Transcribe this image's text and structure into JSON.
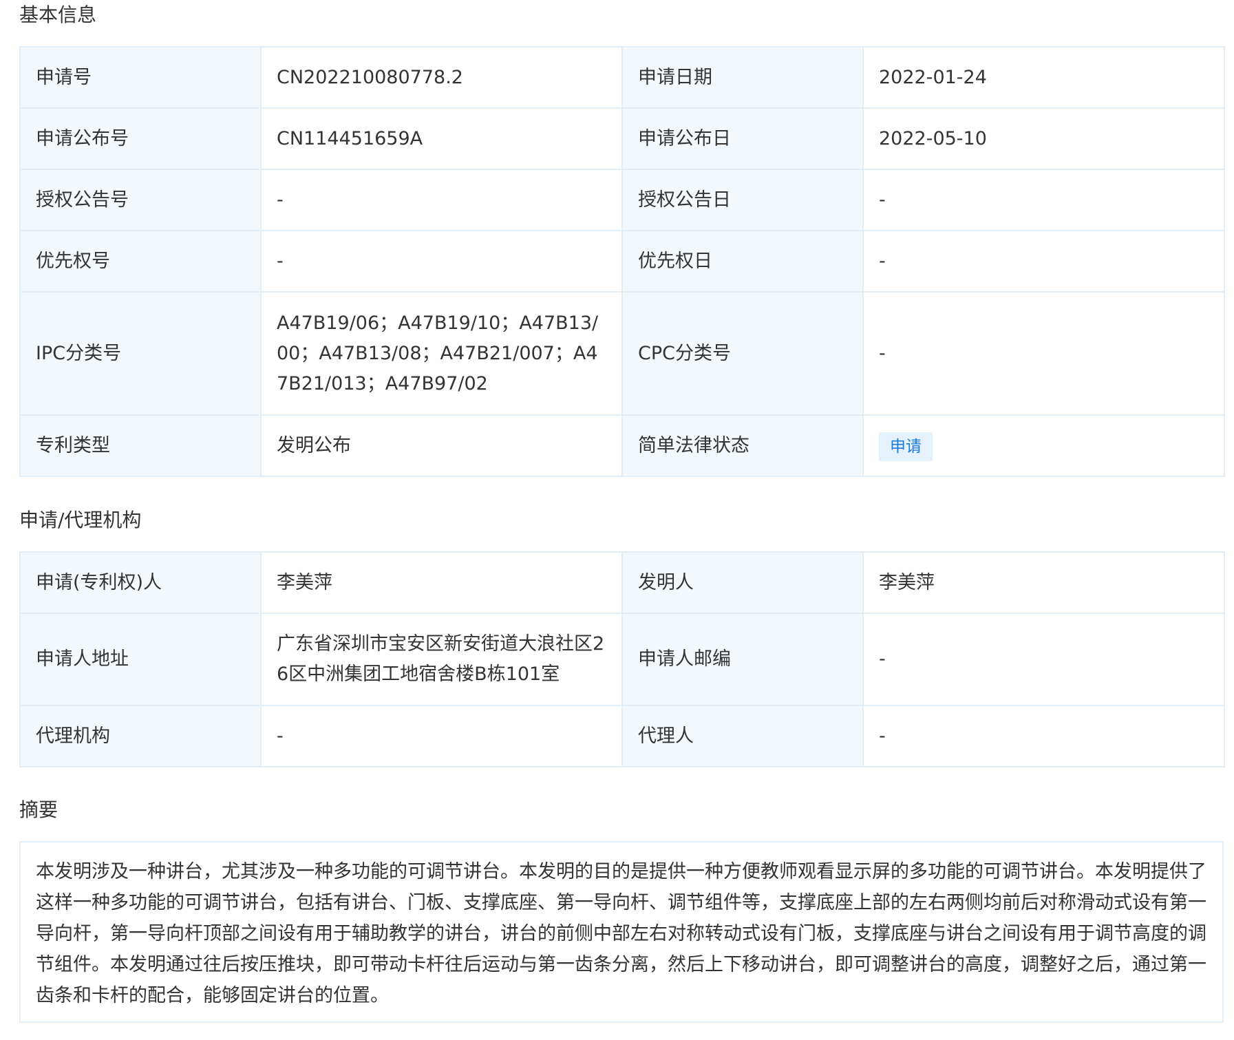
{
  "basic": {
    "title": "基本信息",
    "rows": [
      {
        "k1": "申请号",
        "v1": "CN202210080778.2",
        "k2": "申请日期",
        "v2": "2022-01-24"
      },
      {
        "k1": "申请公布号",
        "v1": "CN114451659A",
        "k2": "申请公布日",
        "v2": "2022-05-10"
      },
      {
        "k1": "授权公告号",
        "v1": "-",
        "k2": "授权公告日",
        "v2": "-"
      },
      {
        "k1": "优先权号",
        "v1": "-",
        "k2": "优先权日",
        "v2": "-"
      },
      {
        "k1": "IPC分类号",
        "v1": "A47B19/06；A47B19/10；A47B13/00；A47B13/08；A47B21/007；A47B21/013；A47B97/02",
        "k2": "CPC分类号",
        "v2": "-"
      },
      {
        "k1": "专利类型",
        "v1": "发明公布",
        "k2": "简单法律状态",
        "v2": "申请"
      }
    ]
  },
  "agency": {
    "title": "申请/代理机构",
    "rows": [
      {
        "k1": "申请(专利权)人",
        "v1": "李美萍",
        "k2": "发明人",
        "v2": "李美萍"
      },
      {
        "k1": "申请人地址",
        "v1": "广东省深圳市宝安区新安街道大浪社区26区中洲集团工地宿舍楼B栋101室",
        "k2": "申请人邮编",
        "v2": "-"
      },
      {
        "k1": "代理机构",
        "v1": "-",
        "k2": "代理人",
        "v2": "-"
      }
    ]
  },
  "abstract": {
    "title": "摘要",
    "text": "本发明涉及一种讲台，尤其涉及一种多功能的可调节讲台。本发明的目的是提供一种方便教师观看显示屏的多功能的可调节讲台。本发明提供了这样一种多功能的可调节讲台，包括有讲台、门板、支撑底座、第一导向杆、调节组件等，支撑底座上部的左右两侧均前后对称滑动式设有第一导向杆，第一导向杆顶部之间设有用于辅助教学的讲台，讲台的前侧中部左右对称转动式设有门板，支撑底座与讲台之间设有用于调节高度的调节组件。本发明通过往后按压推块，即可带动卡杆往后运动与第一齿条分离，然后上下移动讲台，即可调整讲台的高度，调整好之后，通过第一齿条和卡杆的配合，能够固定讲台的位置。"
  },
  "colors": {
    "key_bg": "#f3f8fc",
    "border": "#e3edf6",
    "badge_bg": "#e5f2fd",
    "badge_text": "#1a7ad4"
  }
}
